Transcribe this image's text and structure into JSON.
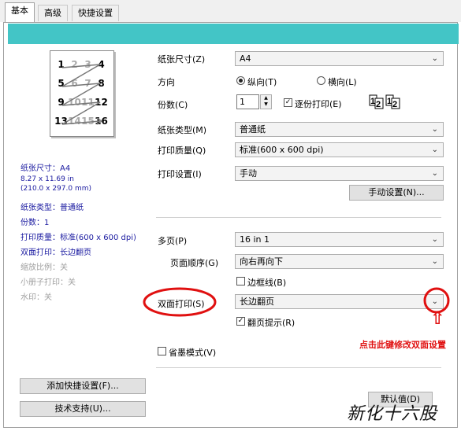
{
  "tabs": [
    "基本",
    "高级",
    "快捷设置"
  ],
  "preview": {
    "pages": [
      "1",
      "2",
      "3",
      "4",
      "5",
      "6",
      "7",
      "8",
      "9",
      "10",
      "11",
      "12",
      "13",
      "14",
      "15",
      "16"
    ]
  },
  "summary": {
    "paper_size": "纸张尺寸：A4",
    "dims_in": "8.27 x 11.69 in",
    "dims_mm": "(210.0 x 297.0 mm)",
    "paper_type": "纸张类型：普通纸",
    "copies": "份数：1",
    "quality": "打印质量：标准(600 x 600 dpi)",
    "duplex": "双面打印：长边翻页",
    "scale": "缩放比例：关",
    "booklet": "小册子打印：关",
    "watermark": "水印：关"
  },
  "form": {
    "paper_size_label": "纸张尺寸(Z)",
    "paper_size_value": "A4",
    "orientation_label": "方向",
    "portrait_label": "纵向(T)",
    "landscape_label": "横向(L)",
    "copies_label": "份数(C)",
    "copies_value": "1",
    "collate_label": "逐份打印(E)",
    "paper_type_label": "纸张类型(M)",
    "paper_type_value": "普通纸",
    "quality_label": "打印质量(Q)",
    "quality_value": "标准(600 x 600 dpi)",
    "print_settings_label": "打印设置(I)",
    "print_settings_value": "手动",
    "manual_settings_btn": "手动设置(N)...",
    "multipage_label": "多页(P)",
    "multipage_value": "16 in 1",
    "page_order_label": "页面顺序(G)",
    "page_order_value": "向右再向下",
    "border_label": "边框线(B)",
    "duplex_label": "双面打印(S)",
    "duplex_value": "长边翻页",
    "flip_hint_label": "翻页提示(R)",
    "toner_save_label": "省墨模式(V)"
  },
  "annotation": {
    "note": "点击此键修改双面设置",
    "up_arrow": "⇧"
  },
  "buttons": {
    "add_shortcut": "添加快捷设置(F)...",
    "tech_support": "技术支持(U)...",
    "default": "默认值(D)"
  },
  "watermark_text": "新化十六股",
  "colors": {
    "band": "#43c5c6",
    "annotation": "#e01010"
  }
}
